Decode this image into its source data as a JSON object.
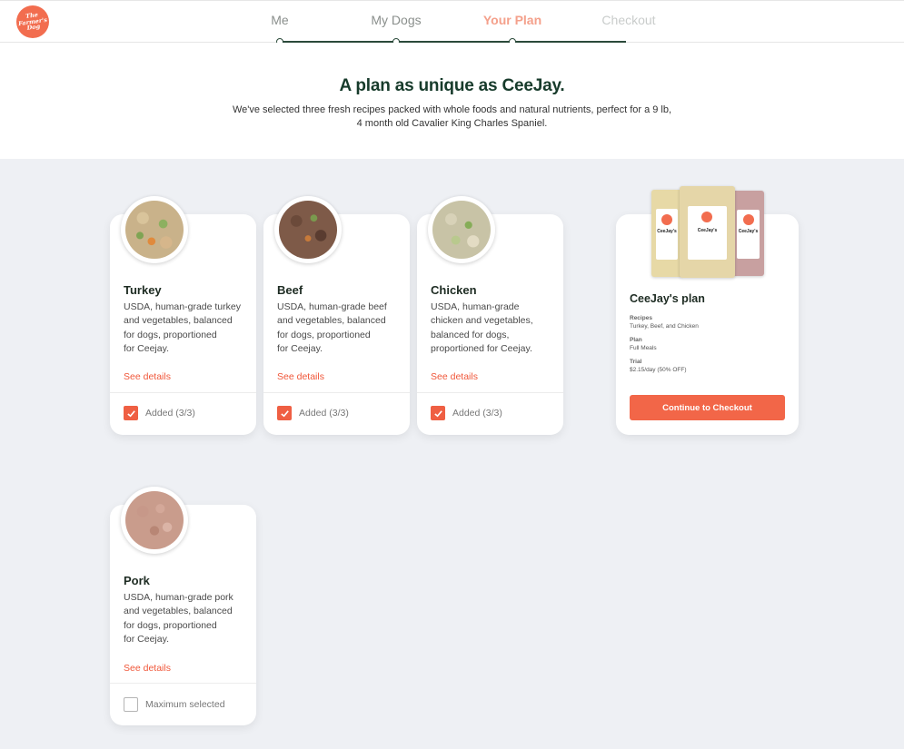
{
  "header": {
    "logo_text": "The Farmer's Dog",
    "steps": [
      {
        "label": "Me",
        "state": "done"
      },
      {
        "label": "My Dogs",
        "state": "done"
      },
      {
        "label": "Your Plan",
        "state": "active"
      },
      {
        "label": "Checkout",
        "state": "future"
      }
    ]
  },
  "hero": {
    "title": "A plan as unique as CeeJay.",
    "subtitle_line1": "We've selected three fresh recipes packed with whole foods and natural nutrients, perfect for a 9 lb,",
    "subtitle_line2": "4 month old Cavalier King Charles Spaniel."
  },
  "recipes": [
    {
      "name": "Turkey",
      "desc": [
        "USDA, human-grade turkey",
        "and vegetables, balanced",
        "for dogs, proportioned",
        "for Ceejay."
      ],
      "details": "See details",
      "status": "Added (3/3)",
      "checked": true
    },
    {
      "name": "Beef",
      "desc": [
        "USDA, human-grade beef",
        "and vegetables, balanced",
        "for dogs, proportioned",
        "for Ceejay."
      ],
      "details": "See details",
      "status": "Added (3/3)",
      "checked": true
    },
    {
      "name": "Chicken",
      "desc": [
        "USDA, human-grade",
        "chicken and vegetables,",
        "balanced for dogs,",
        "proportioned for Ceejay."
      ],
      "details": "See details",
      "status": "Added (3/3)",
      "checked": true
    },
    {
      "name": "Pork",
      "desc": [
        "USDA, human-grade pork",
        "and vegetables, balanced",
        "for dogs, proportioned",
        "for Ceejay."
      ],
      "details": "See details",
      "status": "Maximum selected",
      "checked": false
    }
  ],
  "plan": {
    "title": "CeeJay's plan",
    "bag_label_center": "CeeJay's",
    "bag_label_left": "CeeJay's",
    "bag_label_right": "CeeJay's",
    "recipes_label": "Recipes",
    "recipes_value": "Turkey, Beef, and Chicken",
    "plan_label": "Plan",
    "plan_value": "Full Meals",
    "trial_label": "Trial",
    "trial_value": "$2.15/day (50% OFF)",
    "cta": "Continue to Checkout"
  },
  "colors": {
    "accent": "#f26648",
    "brand_green": "#173b2b",
    "background": "#eef0f4"
  }
}
